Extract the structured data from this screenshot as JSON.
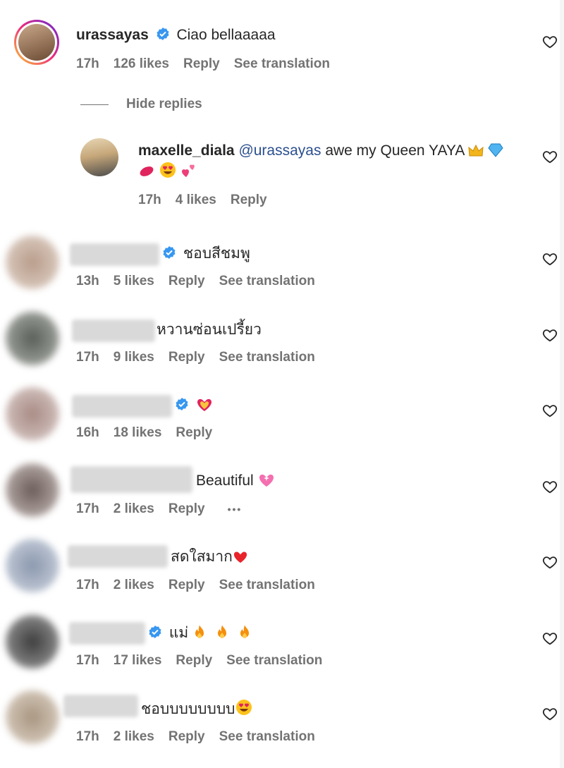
{
  "comments": [
    {
      "username": "urassayas",
      "text": "Ciao bellaaaaa",
      "time": "17h",
      "likes": "126 likes",
      "reply": "Reply",
      "translation": "See translation"
    },
    {
      "username": "",
      "text": "ชอบสีชมพู",
      "time": "13h",
      "likes": "5 likes",
      "reply": "Reply",
      "translation": "See translation"
    },
    {
      "username": "",
      "text": "หวานซ่อนเปรี้ยว",
      "time": "17h",
      "likes": "9 likes",
      "reply": "Reply",
      "translation": "See translation"
    },
    {
      "username": "",
      "text": "",
      "time": "16h",
      "likes": "18 likes",
      "reply": "Reply"
    },
    {
      "username": "",
      "text": "Beautiful",
      "time": "17h",
      "likes": "2 likes",
      "reply": "Reply",
      "more": "•••"
    },
    {
      "username": "",
      "text": "สดใสมาก",
      "time": "17h",
      "likes": "2 likes",
      "reply": "Reply",
      "translation": "See translation"
    },
    {
      "username": "",
      "text": "แม่",
      "time": "17h",
      "likes": "17 likes",
      "reply": "Reply",
      "translation": "See translation"
    },
    {
      "username": "",
      "text": "ชอบบบบบบบบ",
      "time": "17h",
      "likes": "2 likes",
      "reply": "Reply",
      "translation": "See translation"
    }
  ],
  "replies_toggle": {
    "label": "Hide replies"
  },
  "reply": {
    "username": "maxelle_diala",
    "mention": "@urassayas",
    "text": "awe my Queen YAYA",
    "time": "17h",
    "likes": "4 likes",
    "reply": "Reply"
  },
  "icons": {
    "heart": "heart-outline-icon",
    "verified": "verified-badge-icon"
  },
  "colors": {
    "verified": "#3797f0",
    "meta_text": "#737373",
    "mention": "#2b4f8f"
  }
}
